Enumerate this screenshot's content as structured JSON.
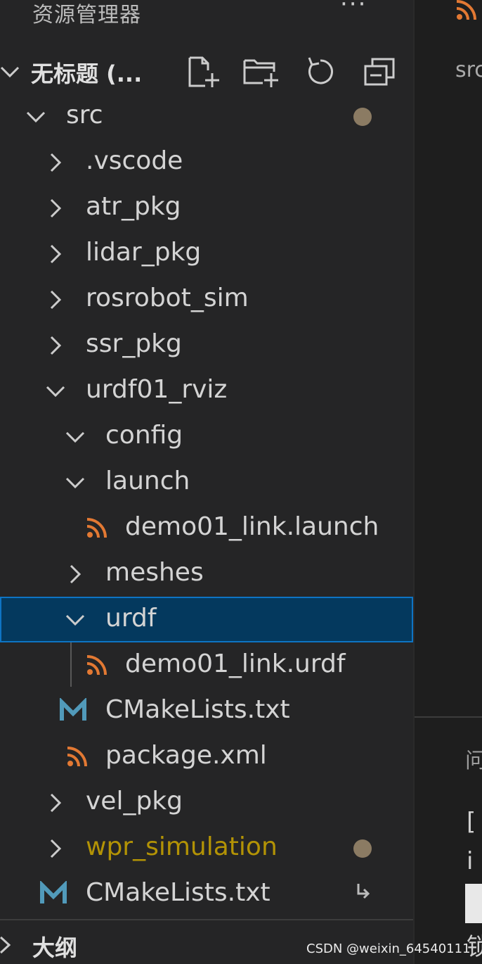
{
  "explorer": {
    "title": "资源管理器",
    "more_label": "···",
    "workspace_title": "无标题 (...",
    "actions": [
      {
        "name": "new-file",
        "icon": "new-file-icon"
      },
      {
        "name": "new-folder",
        "icon": "new-folder-icon"
      },
      {
        "name": "refresh",
        "icon": "refresh-icon"
      },
      {
        "name": "collapse-all",
        "icon": "collapse-all-icon"
      }
    ]
  },
  "tree": [
    {
      "label": "src",
      "depth": 1,
      "type": "folder",
      "expanded": true,
      "modified": true
    },
    {
      "label": ".vscode",
      "depth": 2,
      "type": "folder",
      "expanded": false
    },
    {
      "label": "atr_pkg",
      "depth": 2,
      "type": "folder",
      "expanded": false
    },
    {
      "label": "lidar_pkg",
      "depth": 2,
      "type": "folder",
      "expanded": false
    },
    {
      "label": "rosrobot_sim",
      "depth": 2,
      "type": "folder",
      "expanded": false
    },
    {
      "label": "ssr_pkg",
      "depth": 2,
      "type": "folder",
      "expanded": false
    },
    {
      "label": "urdf01_rviz",
      "depth": 2,
      "type": "folder",
      "expanded": true
    },
    {
      "label": "config",
      "depth": 3,
      "type": "folder",
      "expanded": true
    },
    {
      "label": "launch",
      "depth": 3,
      "type": "folder",
      "expanded": true
    },
    {
      "label": "demo01_link.launch",
      "depth": 4,
      "type": "file",
      "icon": "rss-xml-icon"
    },
    {
      "label": "meshes",
      "depth": 3,
      "type": "folder",
      "expanded": false
    },
    {
      "label": "urdf",
      "depth": 3,
      "type": "folder",
      "expanded": true,
      "selected": true
    },
    {
      "label": "demo01_link.urdf",
      "depth": 4,
      "type": "file",
      "icon": "rss-xml-icon"
    },
    {
      "label": "CMakeLists.txt",
      "depth": 3,
      "type": "file",
      "icon": "cmake-m-icon"
    },
    {
      "label": "package.xml",
      "depth": 3,
      "type": "file",
      "icon": "rss-xml-icon"
    },
    {
      "label": "vel_pkg",
      "depth": 2,
      "type": "folder",
      "expanded": false
    },
    {
      "label": "wpr_simulation",
      "depth": 2,
      "type": "folder",
      "expanded": false,
      "modified": true
    },
    {
      "label": "CMakeLists.txt",
      "depth": 2,
      "type": "file",
      "icon": "cmake-m-icon",
      "symlink": true
    }
  ],
  "outline": {
    "title": "大纲"
  },
  "editor": {
    "breadcrumb": "src",
    "panel_tab": "问",
    "terminal_lines": [
      "[",
      "i"
    ],
    "terminal_bottom": "锁"
  },
  "watermark": "CSDN @weixin_64540111",
  "colors": {
    "sidebar_bg": "#252526",
    "selected_bg": "#04395e",
    "selected_border": "#0e74c4",
    "xml_icon": "#e37933",
    "cmake_icon": "#519aba",
    "modified_dot": "#8b7b63",
    "modified_text": "#cca700"
  }
}
